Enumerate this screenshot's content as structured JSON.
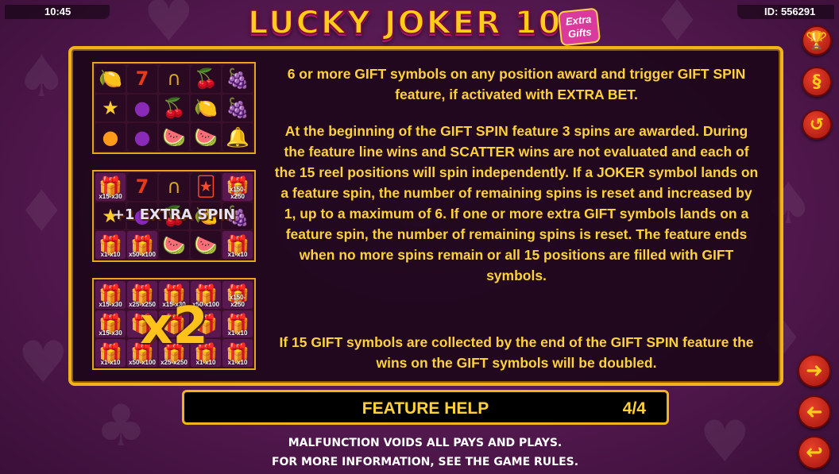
{
  "status_bar": {
    "time": "10:45",
    "id_label": "ID: 556291"
  },
  "logo": {
    "title": "LUCKY JOKER 10",
    "badge_line1": "Extra",
    "badge_line2": "Gifts"
  },
  "help_page": {
    "example_overlays": {
      "extra_spin": "+1 EXTRA SPIN",
      "double": "x2"
    },
    "example_multipliers": {
      "grid2": [
        "x15-x30",
        "x150-x250",
        "x1-x10",
        "x50-x100",
        "x1-x10"
      ],
      "grid3": [
        "x15-x30",
        "x25-x250",
        "x15-x30",
        "x50-x100",
        "x150-x250",
        "x15-x30",
        "x1-x10",
        "x1-x10",
        "x50-x100",
        "x25-x250",
        "x1-x10",
        "x1-x10"
      ]
    },
    "paragraphs": [
      "6 or more GIFT symbols on any position award and trigger GIFT SPIN feature, if activated with EXTRA BET.",
      "At the beginning of the GIFT SPIN feature 3 spins are awarded. During the feature line wins and SCATTER wins are not evaluated and each of the 15 reel positions will spin independently. If a JOKER symbol lands on a feature spin, the number of remaining spins is reset and increased by 1, up to a maximum of 6. If one or more extra GIFT symbols lands on a feature spin, the number of remaining spins is reset. The feature ends when no more spins remain or all 15 positions are filled with GIFT symbols.",
      "If 15 GIFT symbols are collected by the end of the GIFT SPIN feature the wins on the GIFT symbols will be doubled."
    ]
  },
  "feature_bar": {
    "title": "FEATURE HELP",
    "page": "4/4"
  },
  "disclaimer": {
    "line1": "MALFUNCTION VOIDS ALL PAYS AND PLAYS.",
    "line2": "FOR MORE INFORMATION, SEE THE GAME RULES."
  },
  "icons": {
    "trophy": "trophy-icon",
    "rules": "section-icon",
    "history": "history-icon",
    "next": "arrow-right-icon",
    "prev": "arrow-left-icon",
    "back": "return-icon"
  },
  "colors": {
    "accent_gold": "#f2b21a",
    "text_gold": "#ffd23a",
    "button_red": "#c8261c",
    "background": "#5a1b55"
  }
}
